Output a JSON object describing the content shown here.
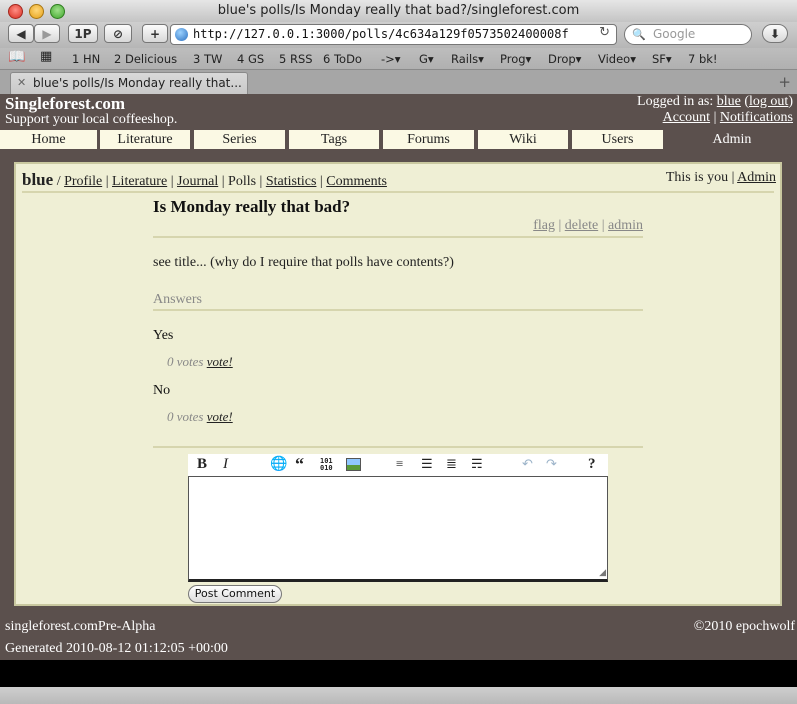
{
  "window": {
    "title": "blue's polls/Is Monday really that bad?/singleforest.com"
  },
  "toolbar": {
    "onepassword_label": "1P",
    "url": "http://127.0.0.1:3000/polls/4c634a129f0573502400008f",
    "search_placeholder": "Google"
  },
  "bookmarks": [
    "1 HN",
    "2 Delicious",
    "3 TW",
    "4 GS",
    "5 RSS",
    "6 ToDo",
    "->▾",
    "G▾",
    "Rails▾",
    "Prog▾",
    "Drop▾",
    "Video▾",
    "SF▾",
    "7 bk!"
  ],
  "tab": {
    "title": "blue's polls/Is Monday really that..."
  },
  "site": {
    "logo": "Singleforest.com",
    "tagline": "Support your local coffeeshop.",
    "logged_in_prefix": "Logged in as:",
    "username": "blue",
    "logout": "log out",
    "account": "Account",
    "notifications": "Notifications"
  },
  "nav": [
    "Home",
    "Literature",
    "Series",
    "Tags",
    "Forums",
    "Wiki",
    "Users",
    "Admin"
  ],
  "user_links": {
    "name": "blue",
    "profile": "Profile",
    "literature": "Literature",
    "journal": "Journal",
    "polls": "Polls",
    "statistics": "Statistics",
    "comments": "Comments",
    "this_is_you": "This is you |",
    "admin": "Admin"
  },
  "poll": {
    "title": "Is Monday really that bad?",
    "flag": "flag",
    "delete": "delete",
    "admin": "admin",
    "body": "see title... (why do I require that polls have contents?)",
    "answers_heading": "Answers",
    "answers": [
      {
        "text": "Yes",
        "votes": "0 votes",
        "vote_link": "vote!"
      },
      {
        "text": "No",
        "votes": "0 votes",
        "vote_link": "vote!"
      }
    ]
  },
  "comment": {
    "post_button": "Post Comment"
  },
  "footer": {
    "site": "singleforest.com",
    "stage": "Pre-Alpha",
    "copyright": "©2010 epochwolf",
    "generated": "Generated 2010-08-12 01:12:05 +00:00"
  }
}
